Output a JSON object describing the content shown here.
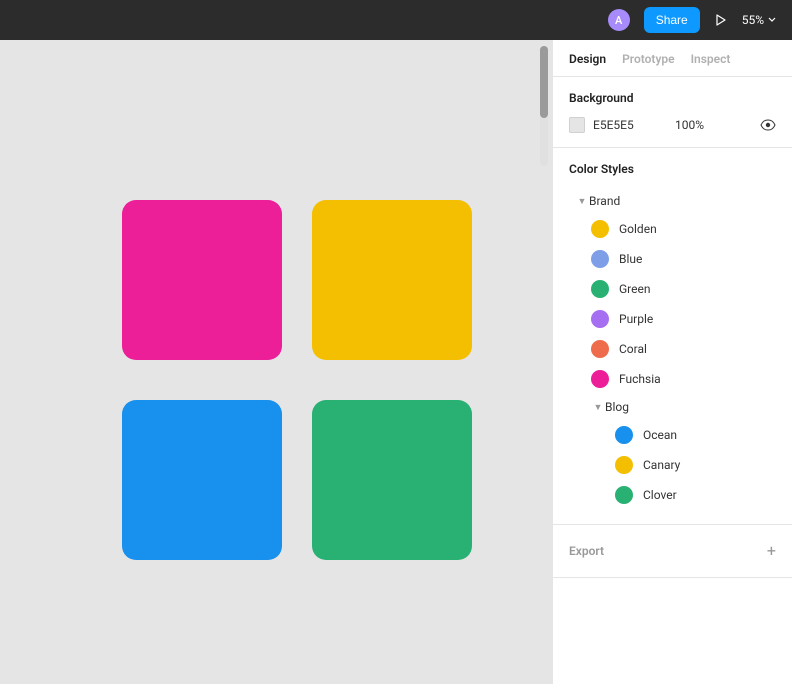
{
  "topbar": {
    "avatar_initial": "A",
    "share_label": "Share",
    "zoom_label": "55%"
  },
  "canvas": {
    "shapes": [
      {
        "color": "#ec1e98"
      },
      {
        "color": "#f4bf00"
      },
      {
        "color": "#1790ee"
      },
      {
        "color": "#29b173"
      }
    ]
  },
  "panel": {
    "tabs": {
      "design": "Design",
      "prototype": "Prototype",
      "inspect": "Inspect"
    },
    "background": {
      "title": "Background",
      "hex": "E5E5E5",
      "opacity": "100%"
    },
    "color_styles": {
      "title": "Color Styles",
      "groups": [
        {
          "name": "Brand",
          "items": [
            {
              "name": "Golden",
              "color": "#f4bf00"
            },
            {
              "name": "Blue",
              "color": "#7f9ee8"
            },
            {
              "name": "Green",
              "color": "#29b173"
            },
            {
              "name": "Purple",
              "color": "#a66ef0"
            },
            {
              "name": "Coral",
              "color": "#ee6b4b"
            },
            {
              "name": "Fuchsia",
              "color": "#ec1e98"
            }
          ],
          "subgroups": [
            {
              "name": "Blog",
              "items": [
                {
                  "name": "Ocean",
                  "color": "#1790ee"
                },
                {
                  "name": "Canary",
                  "color": "#f4bf00"
                },
                {
                  "name": "Clover",
                  "color": "#29b173"
                }
              ]
            }
          ]
        }
      ]
    },
    "export": {
      "title": "Export"
    }
  }
}
